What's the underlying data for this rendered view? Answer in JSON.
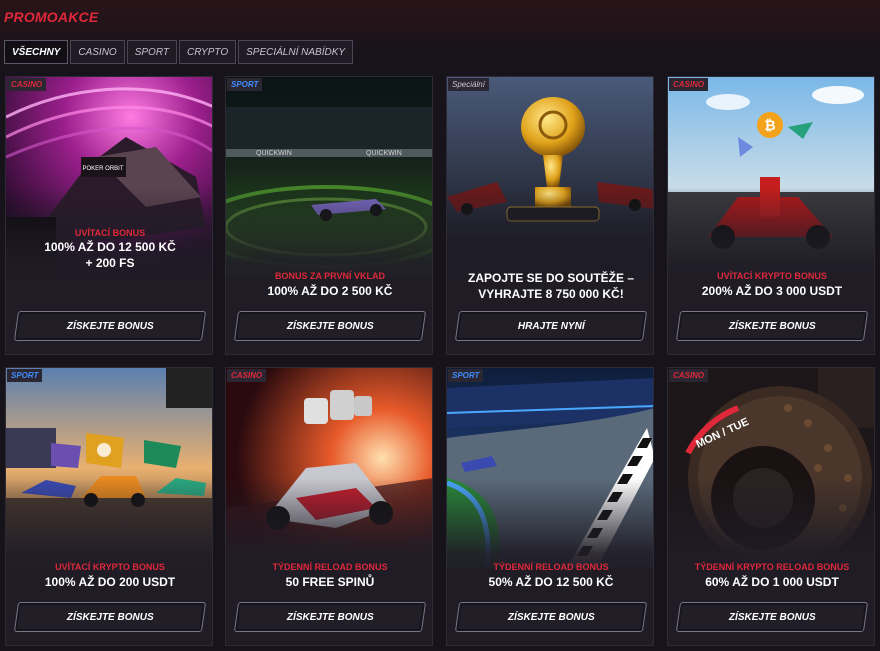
{
  "page_title": "PROMOAKCE",
  "tabs": [
    {
      "label": "VŠECHNY",
      "active": true
    },
    {
      "label": "CASINO",
      "active": false
    },
    {
      "label": "SPORT",
      "active": false
    },
    {
      "label": "CRYPTO",
      "active": false
    },
    {
      "label": "SPECIÁLNÍ NABÍDKY",
      "active": false
    }
  ],
  "colors": {
    "accent_red": "#e0283a",
    "sport_blue": "#3f8cff",
    "background": "#16131b",
    "card": "#1f1c26"
  },
  "cards": [
    {
      "badge": "CASINO",
      "subtitle": "UVÍTACÍ BONUS",
      "title_line1": "100% AŽ DO 12 500 KČ",
      "title_line2": "+ 200 FS",
      "button": "ZÍSKEJTE BONUS",
      "image_sign": "POKER ORBIT"
    },
    {
      "badge": "SPORT",
      "subtitle": "BONUS ZA PRVNÍ VKLAD",
      "title_line1": "100% AŽ DO 2 500 KČ",
      "title_line2": "",
      "button": "ZÍSKEJTE BONUS",
      "image_sign": "QUICKWIN"
    },
    {
      "badge": "Speciální",
      "subtitle": "",
      "title_line1": "ZAPOJTE SE DO SOUTĚŽE –",
      "title_line2": "VYHRAJTE 8 750 000 KČ!",
      "button": "HRAJTE NYNÍ"
    },
    {
      "badge": "CASINO",
      "subtitle": "UVÍTACÍ KRYPTO BONUS",
      "title_line1": "200% AŽ DO 3 000 USDT",
      "title_line2": "",
      "button": "ZÍSKEJTE BONUS"
    },
    {
      "badge": "SPORT",
      "subtitle": "UVÍTACÍ KRYPTO BONUS",
      "title_line1": "100% AŽ DO 200 USDT",
      "title_line2": "",
      "button": "ZÍSKEJTE BONUS"
    },
    {
      "badge": "CASINO",
      "subtitle": "TÝDENNÍ RELOAD BONUS",
      "title_line1": "50 FREE SPINŮ",
      "title_line2": "",
      "button": "ZÍSKEJTE BONUS"
    },
    {
      "badge": "SPORT",
      "subtitle": "TÝDENNÍ RELOAD BONUS",
      "title_line1": "50% AŽ DO 12 500 KČ",
      "title_line2": "",
      "button": "ZÍSKEJTE BONUS"
    },
    {
      "badge": "CASINO",
      "subtitle": "TÝDENNÍ KRYPTO RELOAD BONUS",
      "title_line1": "60% AŽ DO 1 000 USDT",
      "title_line2": "",
      "button": "ZÍSKEJTE BONUS",
      "image_sign": "MON / TUE"
    }
  ]
}
